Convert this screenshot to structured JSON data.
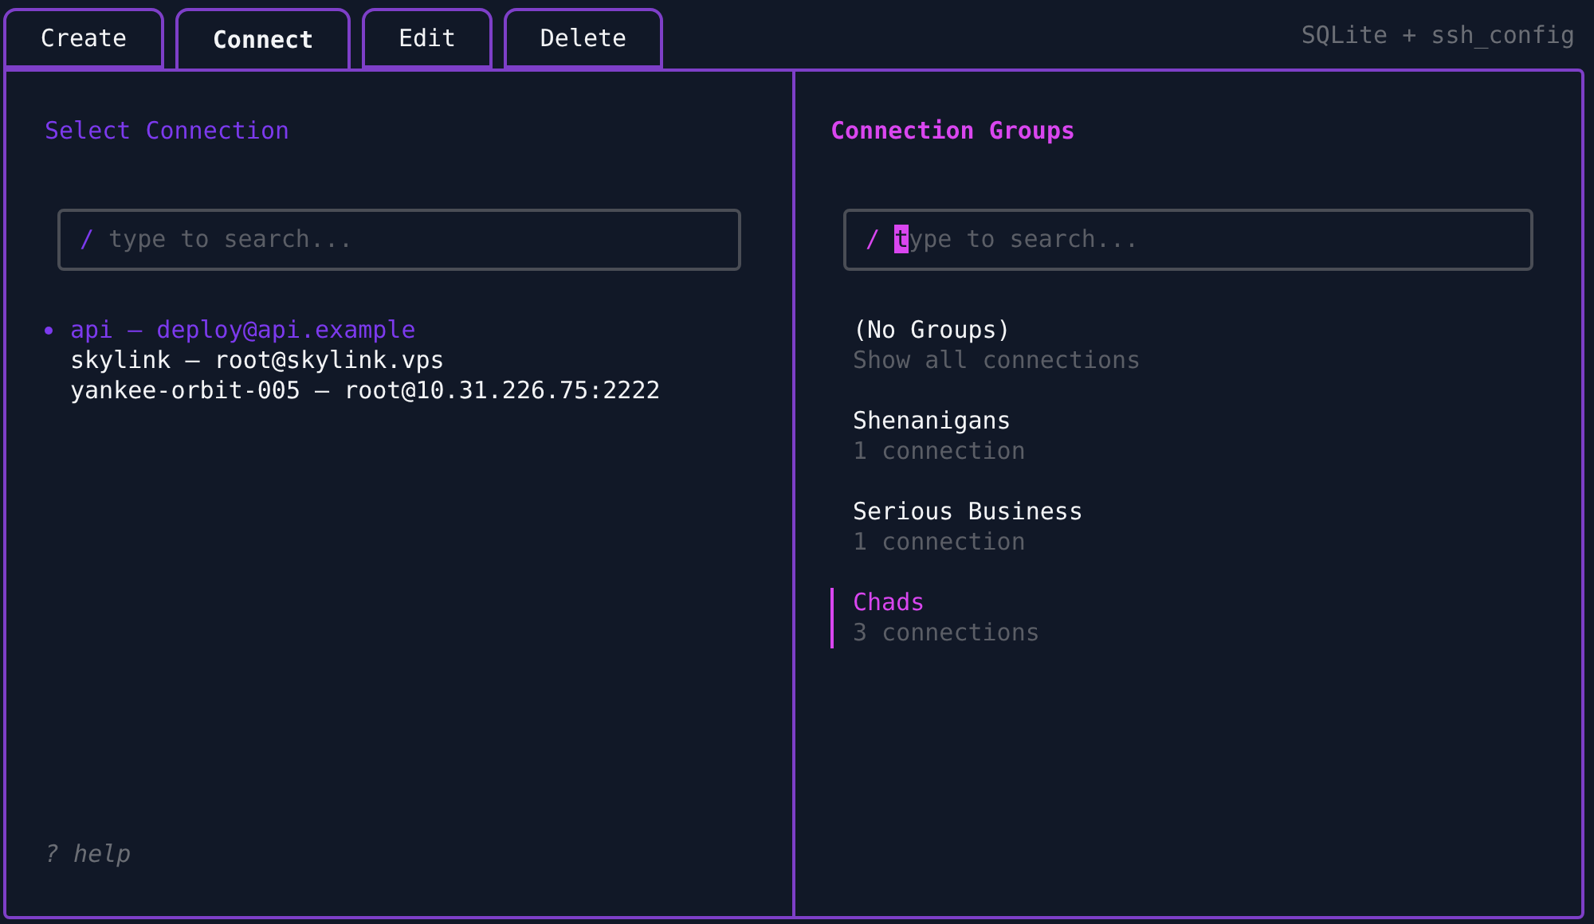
{
  "tabs": [
    {
      "label": "Create",
      "selected": false
    },
    {
      "label": "Connect",
      "selected": true
    },
    {
      "label": "Edit",
      "selected": false
    },
    {
      "label": "Delete",
      "selected": false
    }
  ],
  "backend_label": "SQLite + ssh_config",
  "connections_panel": {
    "title": "Select Connection",
    "focused": false,
    "search": {
      "prefix": "/",
      "placeholder": "type to search..."
    },
    "items": [
      {
        "label": "api – deploy@api.example",
        "selected": true
      },
      {
        "label": "skylink – root@skylink.vps",
        "selected": false
      },
      {
        "label": "yankee-orbit-005 – root@10.31.226.75:2222",
        "selected": false
      }
    ],
    "help": "? help"
  },
  "groups_panel": {
    "title": "Connection Groups",
    "focused": true,
    "search": {
      "prefix": "/",
      "placeholder": "type to search..."
    },
    "items": [
      {
        "name": "(No Groups)",
        "subtitle": "Show all connections",
        "selected": false
      },
      {
        "name": "Shenanigans",
        "subtitle": "1 connection",
        "selected": false
      },
      {
        "name": "Serious Business",
        "subtitle": "1 connection",
        "selected": false
      },
      {
        "name": "Chads",
        "subtitle": "3 connections",
        "selected": true
      }
    ]
  }
}
